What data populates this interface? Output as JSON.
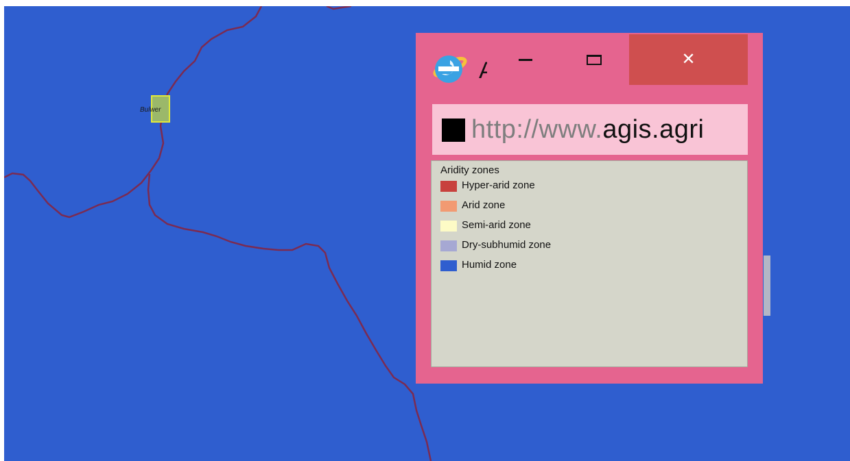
{
  "map": {
    "background_color": "#2f5ecf",
    "border_color": "#7b2b52",
    "place_label": "Bulwer"
  },
  "popup_window": {
    "frame_color": "#e5648f",
    "title_text": "A",
    "app_icon": "internet-explorer-icon",
    "minimize_icon": "minimize-icon",
    "maximize_icon": "maximize-icon",
    "close_icon": "close-icon",
    "close_glyph": "✕",
    "url_dim": "http://www.",
    "url_highlight": "agis.agri"
  },
  "legend": {
    "title": "Aridity zones",
    "items": [
      {
        "label": "Hyper-arid zone",
        "color": "#c8413d"
      },
      {
        "label": "Arid zone",
        "color": "#f29a72"
      },
      {
        "label": "Semi-arid zone",
        "color": "#fdfbc6"
      },
      {
        "label": "Dry-subhumid zone",
        "color": "#a6a8d3"
      },
      {
        "label": "Humid zone",
        "color": "#2f5ecf"
      }
    ]
  }
}
